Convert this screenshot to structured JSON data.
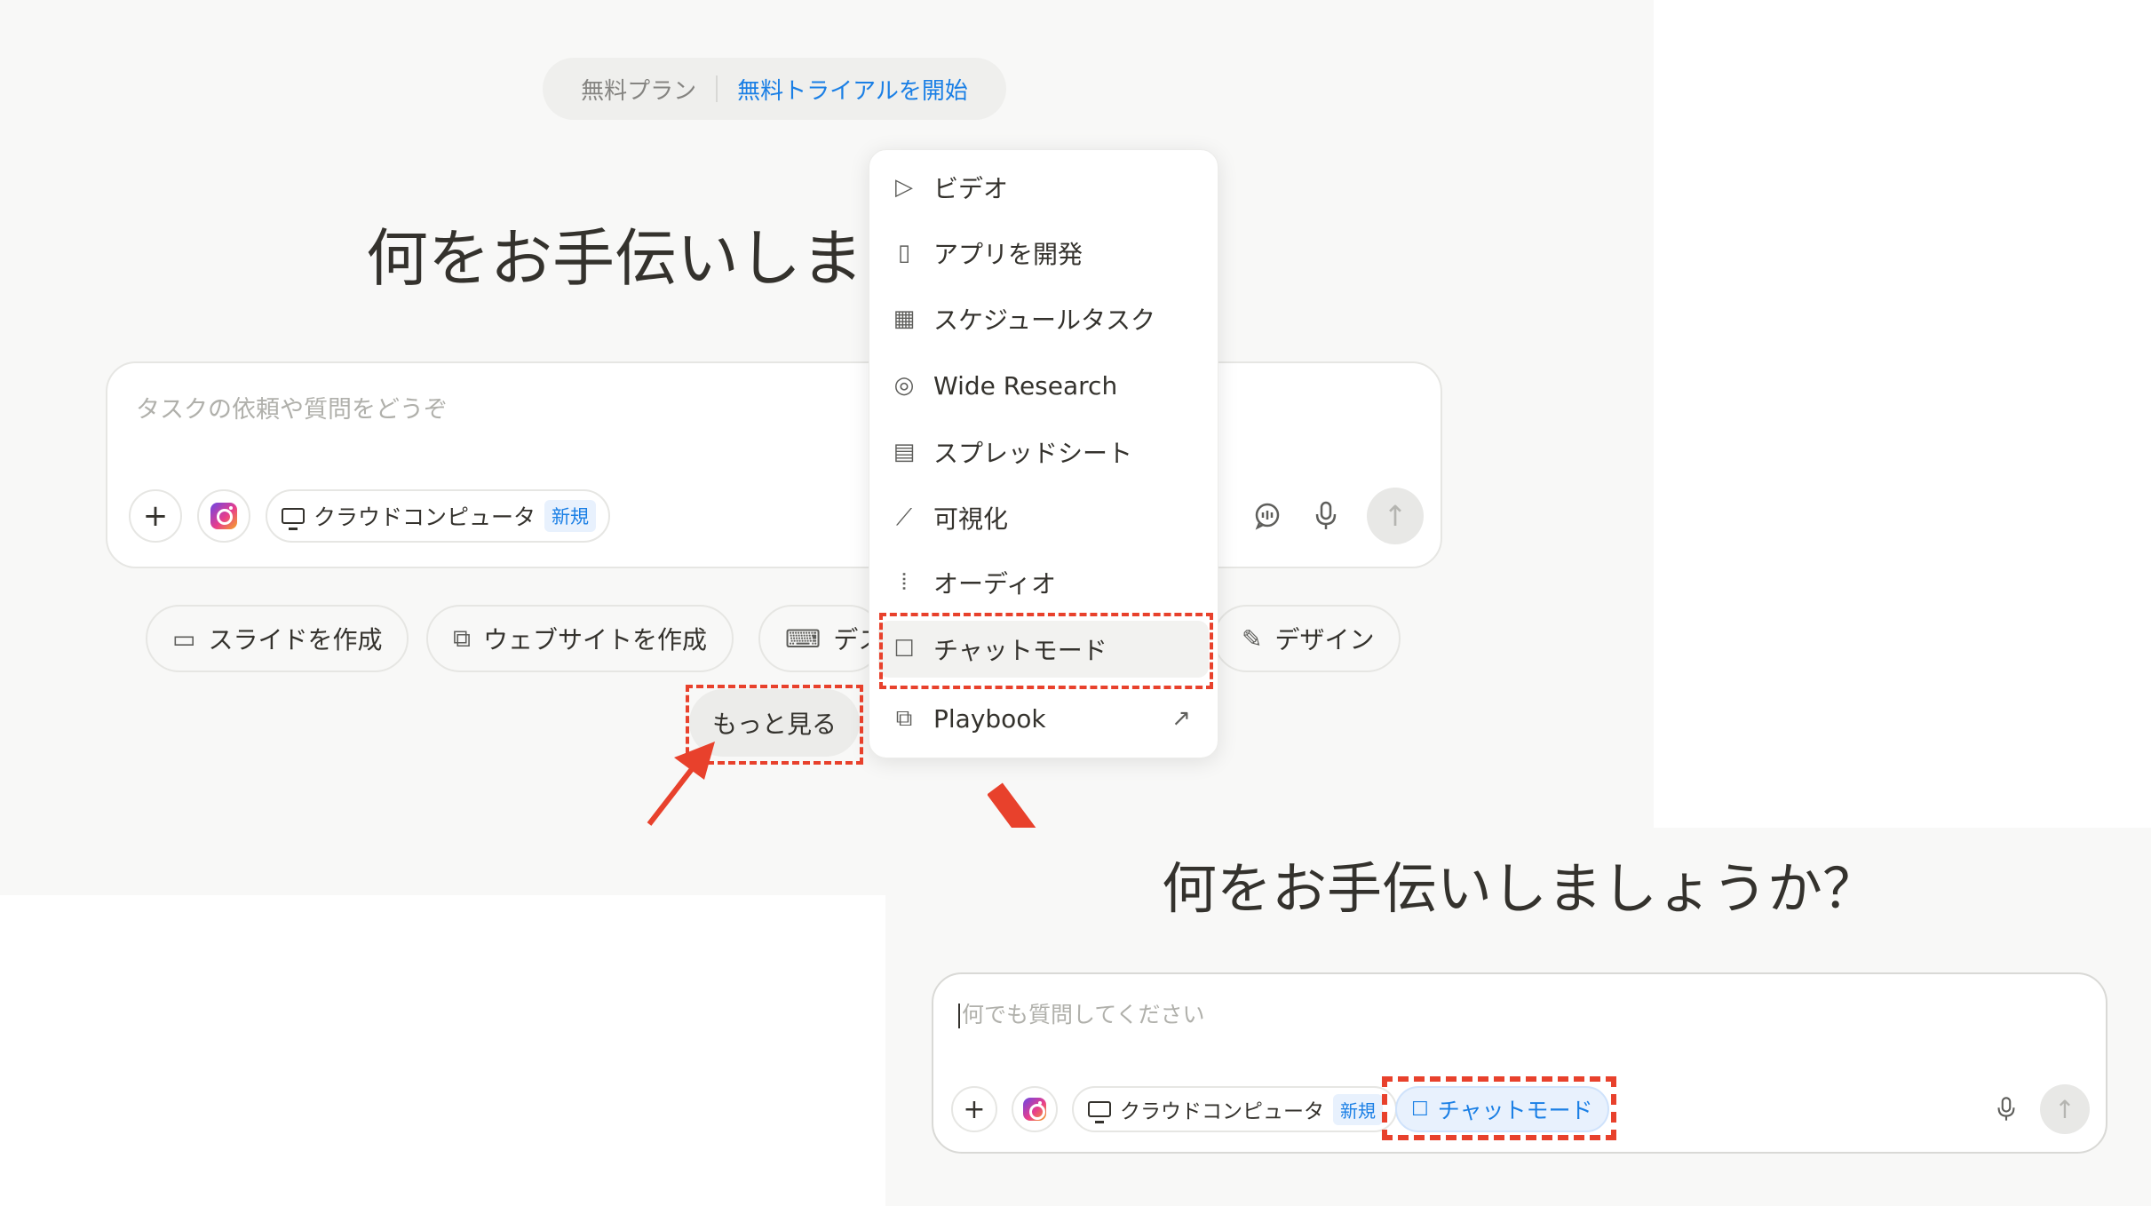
{
  "top_view": {
    "plan_label": "無料プラン",
    "trial_link": "無料トライアルを開始",
    "headline": "何をお手伝いしま",
    "composer": {
      "placeholder": "タスクの依頼や質問をどうぞ",
      "cloud_chip_label": "クラウドコンピュータ",
      "cloud_chip_badge": "新規"
    },
    "quick_actions": [
      {
        "label": "スライドを作成",
        "icon": "slides-icon"
      },
      {
        "label": "ウェブサイトを作成",
        "icon": "website-icon"
      },
      {
        "label": "デス",
        "icon": "laptop-icon"
      },
      {
        "label": "デザイン",
        "icon": "design-icon"
      }
    ],
    "more_button": "もっと見る",
    "menu": [
      {
        "label": "ビデオ",
        "icon": "video-icon"
      },
      {
        "label": "アプリを開発",
        "icon": "phone-icon"
      },
      {
        "label": "スケジュールタスク",
        "icon": "calendar-icon"
      },
      {
        "label": "Wide Research",
        "icon": "research-icon"
      },
      {
        "label": "スプレッドシート",
        "icon": "table-icon"
      },
      {
        "label": "可視化",
        "icon": "chart-icon"
      },
      {
        "label": "オーディオ",
        "icon": "audio-icon"
      },
      {
        "label": "チャットモード",
        "icon": "chat-icon"
      },
      {
        "label": "Playbook",
        "icon": "playbook-icon"
      }
    ]
  },
  "bottom_view": {
    "headline": "何をお手伝いしましょうか？",
    "composer": {
      "placeholder": "何でも質問してください",
      "cloud_chip_label": "クラウドコンピュータ",
      "cloud_chip_badge": "新規",
      "chat_chip_label": "チャットモード"
    }
  },
  "annotation_color": "#e8412c"
}
